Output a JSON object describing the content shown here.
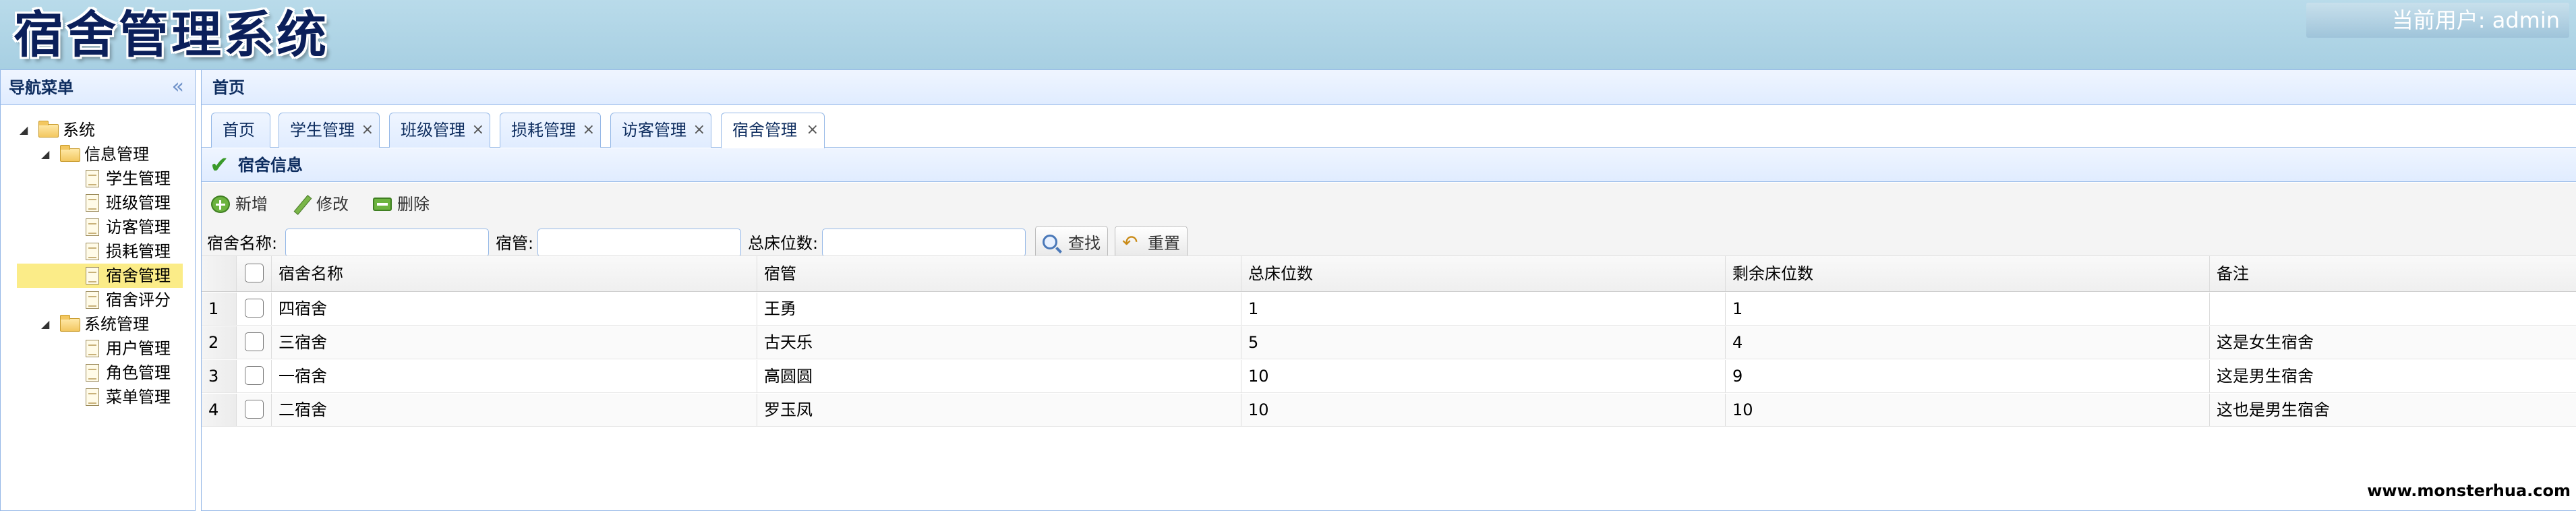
{
  "app": {
    "title": "宿舍管理系统",
    "current_user_label": "当前用户:",
    "current_user": "admin"
  },
  "nav": {
    "title": "导航菜单",
    "collapse_icon": "«",
    "tree": [
      {
        "label": "系统",
        "type": "folder",
        "expanded": true,
        "level": 0
      },
      {
        "label": "信息管理",
        "type": "folder",
        "expanded": true,
        "level": 1
      },
      {
        "label": "学生管理",
        "type": "file",
        "level": 2
      },
      {
        "label": "班级管理",
        "type": "file",
        "level": 2
      },
      {
        "label": "访客管理",
        "type": "file",
        "level": 2
      },
      {
        "label": "损耗管理",
        "type": "file",
        "level": 2
      },
      {
        "label": "宿舍管理",
        "type": "file",
        "level": 2,
        "selected": true
      },
      {
        "label": "宿舍评分",
        "type": "file",
        "level": 2
      },
      {
        "label": "系统管理",
        "type": "folder",
        "expanded": true,
        "level": 1
      },
      {
        "label": "用户管理",
        "type": "file",
        "level": 2
      },
      {
        "label": "角色管理",
        "type": "file",
        "level": 2
      },
      {
        "label": "菜单管理",
        "type": "file",
        "level": 2
      }
    ]
  },
  "main": {
    "title": "首页",
    "tabs": [
      {
        "label": "首页",
        "closable": false
      },
      {
        "label": "学生管理",
        "closable": true
      },
      {
        "label": "班级管理",
        "closable": true
      },
      {
        "label": "损耗管理",
        "closable": true
      },
      {
        "label": "访客管理",
        "closable": true
      },
      {
        "label": "宿舍管理",
        "closable": true,
        "active": true
      }
    ],
    "tab_close_glyph": "×",
    "panel_title": "宿舍信息",
    "toolbar": {
      "add": "新增",
      "edit": "修改",
      "delete": "删除"
    },
    "search": {
      "name_label": "宿舍名称:",
      "name_value": "",
      "manager_label": "宿管:",
      "manager_value": "",
      "beds_label": "总床位数:",
      "beds_value": "",
      "search_button": "查找",
      "reset_button": "重置"
    },
    "grid": {
      "columns": [
        "宿舍名称",
        "宿管",
        "总床位数",
        "剩余床位数",
        "备注"
      ],
      "rows": [
        {
          "num": "1",
          "name": "四宿舍",
          "manager": "王勇",
          "total": "1",
          "remaining": "1",
          "remark": ""
        },
        {
          "num": "2",
          "name": "三宿舍",
          "manager": "古天乐",
          "total": "5",
          "remaining": "4",
          "remark": "这是女生宿舍"
        },
        {
          "num": "3",
          "name": "一宿舍",
          "manager": "高圆圆",
          "total": "10",
          "remaining": "9",
          "remark": "这是男生宿舍"
        },
        {
          "num": "4",
          "name": "二宿舍",
          "manager": "罗玉凤",
          "total": "10",
          "remaining": "10",
          "remark": "这也是男生宿舍"
        }
      ]
    }
  },
  "watermark": "www.monsterhua.com",
  "colors": {
    "header_bg": "#b9dbea",
    "panel_border": "#95b8e7",
    "selected_node": "#fbec88",
    "title_dark": "#0b1f5a"
  }
}
